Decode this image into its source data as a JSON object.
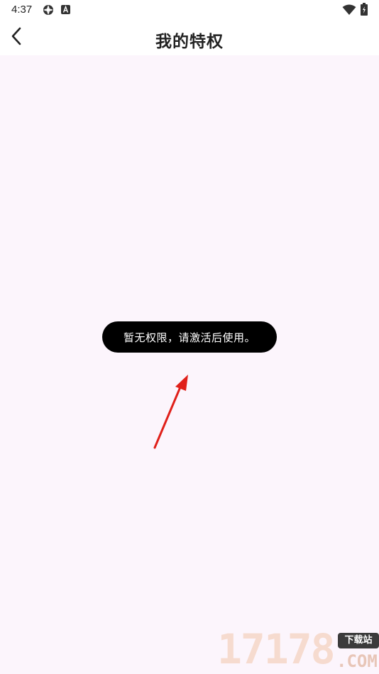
{
  "status_bar": {
    "time": "4:37",
    "icons": [
      "settings-app-icon",
      "a-app-icon",
      "wifi-icon",
      "battery-icon"
    ]
  },
  "header": {
    "back_icon": "chevron-left-icon",
    "title": "我的特权"
  },
  "toast": {
    "message": "暂无权限，请激活后使用。"
  },
  "annotation": {
    "arrow_color": "#e0201a"
  },
  "watermark": {
    "number": "17178",
    "badge": "下载站",
    "domain": ".COM"
  },
  "colors": {
    "content_background": "#fcf5fc",
    "toast_background": "#000000",
    "title_text": "#222222"
  }
}
